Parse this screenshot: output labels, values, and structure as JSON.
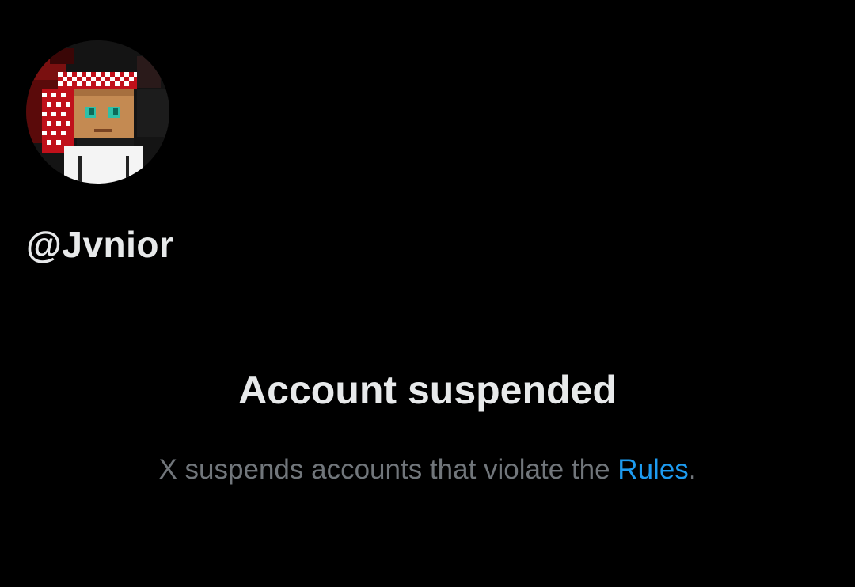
{
  "profile": {
    "handle": "@Jvnior",
    "avatar_icon": "pixel-art-avatar-icon"
  },
  "notice": {
    "title": "Account suspended",
    "description_prefix": "X suspends accounts that violate the ",
    "rules_link_label": "Rules",
    "description_suffix": "."
  },
  "colors": {
    "background": "#000000",
    "primary_text": "#e7e9ea",
    "secondary_text": "#71767b",
    "link": "#1d9bf0"
  }
}
